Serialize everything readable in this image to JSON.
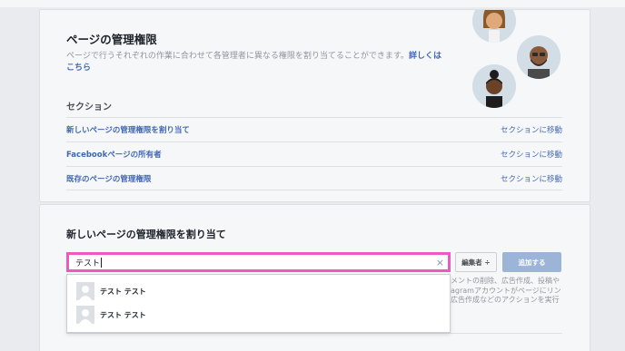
{
  "header": {
    "title": "ページの管理権限",
    "description": "ページで行うそれぞれの作業に合わせて各管理者に異なる権限を割り当てることができます。",
    "learn_more": "詳しくはこちら"
  },
  "sections": {
    "label": "セクション",
    "items": [
      {
        "label": "新しいページの管理権限を割り当て",
        "link": "セクションに移動"
      },
      {
        "label": "Facebookページの所有者",
        "link": "セクションに移動"
      },
      {
        "label": "既存のページの管理権限",
        "link": "セクションに移動"
      }
    ]
  },
  "assign": {
    "title": "新しいページの管理権限を割り当て",
    "search_value": "テスト",
    "clear_icon": "close-icon",
    "role_select": "編集者 ÷",
    "add_button": "追加する",
    "helper_text": "メントの削除、広告作成、投稿やagramアカウントがページにリン広告作成などのアクションを実行で",
    "suggestions": [
      {
        "name": "テスト テスト"
      },
      {
        "name": "テスト テスト"
      }
    ]
  },
  "colors": {
    "highlight": "#ee59c1",
    "link": "#4267b2",
    "disabled_button": "#9cb4d8"
  }
}
